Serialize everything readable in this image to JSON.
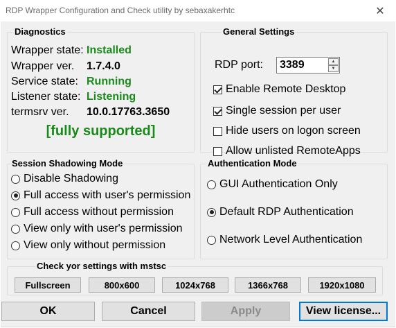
{
  "window": {
    "title": "RDP Wrapper Configuration and Check utility by sebaxakerhtc",
    "close_glyph": "✕"
  },
  "diagnostics": {
    "label": "Diagnostics",
    "rows": [
      {
        "label": "Wrapper state:",
        "value": "Installed",
        "green": true
      },
      {
        "label": "Wrapper ver.",
        "value": "1.7.4.0",
        "green": false
      },
      {
        "label": "Service state:",
        "value": "Running",
        "green": true
      },
      {
        "label": "Listener state:",
        "value": "Listening",
        "green": true
      },
      {
        "label": "termsrv ver.",
        "value": "10.0.17763.3650",
        "green": false
      }
    ],
    "support_status": "[fully supported]"
  },
  "general": {
    "label": "General Settings",
    "port_label": "RDP port:",
    "port_value": "3389",
    "options": [
      {
        "label": "Enable Remote Desktop",
        "checked": true
      },
      {
        "label": "Single session per user",
        "checked": true
      },
      {
        "label": "Hide users on logon screen",
        "checked": false
      },
      {
        "label": "Allow unlisted RemoteApps",
        "checked": false
      }
    ]
  },
  "shadow": {
    "label": "Session Shadowing Mode",
    "options": [
      {
        "label": "Disable Shadowing",
        "checked": false
      },
      {
        "label": "Full access with user's permission",
        "checked": true
      },
      {
        "label": "Full access without permission",
        "checked": false
      },
      {
        "label": "View only with user's permission",
        "checked": false
      },
      {
        "label": "View only without permission",
        "checked": false
      }
    ]
  },
  "auth": {
    "label": "Authentication Mode",
    "options": [
      {
        "label": "GUI Authentication Only",
        "checked": false
      },
      {
        "label": "Default RDP Authentication",
        "checked": true
      },
      {
        "label": "Network Level Authentication",
        "checked": false
      }
    ]
  },
  "mstsc": {
    "label": "Check yor settings with mstsc",
    "buttons": [
      "Fullscreen",
      "800x600",
      "1024x768",
      "1366x768",
      "1920x1080"
    ]
  },
  "footer": {
    "ok": "OK",
    "cancel": "Cancel",
    "apply": "Apply",
    "license": "View license..."
  }
}
